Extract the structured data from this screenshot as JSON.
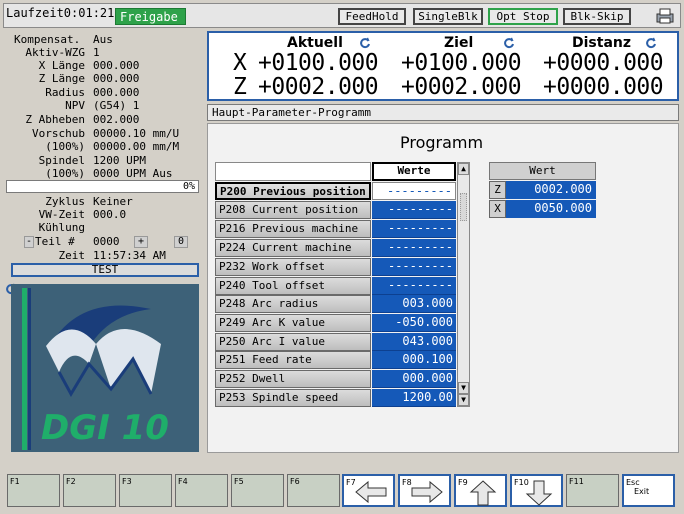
{
  "topbar": {
    "laufzeit": "Laufzeit0:01:21",
    "status": "Freigabe",
    "buttons": [
      {
        "label": "FeedHold"
      },
      {
        "label": "SingleBlk"
      },
      {
        "label": "Opt Stop"
      },
      {
        "label": "Blk-Skip"
      }
    ]
  },
  "left": {
    "rows": [
      {
        "label": "Kompensat.",
        "value": "Aus"
      },
      {
        "label": "Aktiv-WZG",
        "value": "1"
      },
      {
        "label": "X Länge",
        "value": "000.000"
      },
      {
        "label": "Z Länge",
        "value": "000.000"
      },
      {
        "label": "Radius",
        "value": "000.000"
      },
      {
        "label": "NPV",
        "value": "(G54) 1"
      },
      {
        "label": "Z Abheben",
        "value": "002.000"
      },
      {
        "label": "Vorschub",
        "value": "00000.10 mm/U"
      },
      {
        "label": "(100%)",
        "value": "00000.00 mm/M"
      },
      {
        "label": "Spindel",
        "value": "1200 UPM"
      },
      {
        "label": "(100%)",
        "value": "0000 UPM Aus"
      }
    ],
    "progress": "0%",
    "zyklus_label": "Zyklus",
    "zyklus_value": "Keiner",
    "vwzeit_label": "VW-Zeit",
    "vwzeit_value": "000.0",
    "kuehlung_label": "Kühlung",
    "teil_minus": "-",
    "teil_label": "Teil #",
    "teil_value": "0000",
    "teil_plus": "+",
    "teil_count": "0",
    "zeit_label": "Zeit",
    "zeit_value": "11:57:34 AM",
    "test_label": "TEST",
    "logo_text": "DGI 10"
  },
  "position": {
    "headers": {
      "aktuell": "Aktuell",
      "ziel": "Ziel",
      "distanz": "Distanz"
    },
    "x": {
      "axis": "X",
      "aktuell": "+0100.000",
      "ziel": "+0100.000",
      "distanz": "+0000.000"
    },
    "z": {
      "axis": "Z",
      "aktuell": "+0002.000",
      "ziel": "+0002.000",
      "distanz": "+0000.000"
    }
  },
  "panel": {
    "header": "Haupt-Parameter-Programm",
    "title": "Programm",
    "werte_header": "Werte",
    "params": [
      {
        "name": "P200 Previous position",
        "value": "---------"
      },
      {
        "name": "P208 Current position",
        "value": "---------"
      },
      {
        "name": "P216 Previous machine",
        "value": "---------"
      },
      {
        "name": "P224 Current machine",
        "value": "---------"
      },
      {
        "name": "P232 Work offset",
        "value": "---------"
      },
      {
        "name": "P240 Tool offset",
        "value": "---------"
      },
      {
        "name": "P248 Arc radius",
        "value": "003.000"
      },
      {
        "name": "P249 Arc K value",
        "value": "-050.000"
      },
      {
        "name": "P250 Arc I value",
        "value": "043.000"
      },
      {
        "name": "P251 Feed rate",
        "value": "000.100"
      },
      {
        "name": "P252 Dwell",
        "value": "000.000"
      },
      {
        "name": "P253 Spindle speed",
        "value": "1200.00"
      }
    ],
    "wert_header": "Wert",
    "wert_rows": [
      {
        "axis": "Z",
        "value": "0002.000"
      },
      {
        "axis": "X",
        "value": "0050.000"
      }
    ]
  },
  "fkeys": [
    {
      "label": "F1"
    },
    {
      "label": "F2"
    },
    {
      "label": "F3"
    },
    {
      "label": "F4"
    },
    {
      "label": "F5"
    },
    {
      "label": "F6"
    },
    {
      "label": "F7",
      "icon": "arrow-left-icon"
    },
    {
      "label": "F8",
      "icon": "arrow-right-icon"
    },
    {
      "label": "F9",
      "icon": "arrow-up-icon"
    },
    {
      "label": "F10",
      "icon": "arrow-down-icon"
    },
    {
      "label": "F11"
    },
    {
      "label": "Esc",
      "label2": "Exit"
    }
  ],
  "colors": {
    "accent_blue": "#1559b8",
    "frame_blue": "#2b5fa8",
    "green": "#2ea24a",
    "logo_bg": "#3d6178"
  }
}
